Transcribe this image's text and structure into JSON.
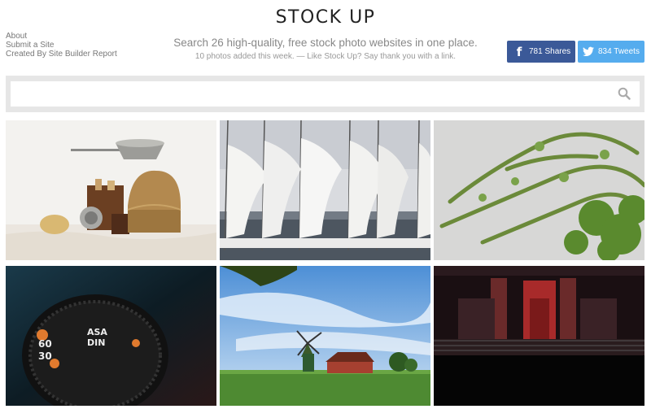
{
  "nav": {
    "about": "About",
    "submit": "Submit a Site",
    "created_by": "Created By Site Builder Report"
  },
  "header": {
    "title": "STOCK UP",
    "tagline": "Search 26 high-quality, free stock photo websites in one place.",
    "subtagline": "10 photos added this week. — Like Stock Up? Say thank you with a link."
  },
  "share": {
    "facebook": {
      "label": "781 Shares",
      "icon": "facebook-icon",
      "color": "#3b5998"
    },
    "twitter": {
      "label": "834 Tweets",
      "icon": "twitter-icon",
      "color": "#55acee"
    }
  },
  "search": {
    "placeholder": "",
    "value": "",
    "icon": "search-icon"
  },
  "photos": [
    {
      "subject": "kitchen still life with colander, jars and wicker basket"
    },
    {
      "subject": "sailboats with white furled sails in harbor"
    },
    {
      "subject": "ivy vines climbing white wall"
    },
    {
      "subject": "camera mode dial close-up"
    },
    {
      "subject": "windmill and red house landscape"
    },
    {
      "subject": "dark subway station platform"
    }
  ]
}
